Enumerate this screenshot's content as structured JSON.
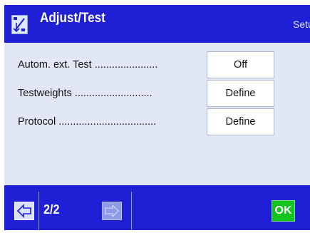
{
  "header": {
    "title": "Adjust/Test",
    "right_label": "Setup",
    "icon": "adjust-test-icon"
  },
  "rows": [
    {
      "label": "Autom. ext. Test ......................",
      "value": "Off"
    },
    {
      "label": "Testweights ...........................",
      "value": "Define"
    },
    {
      "label": "Protocol ..................................",
      "value": "Define"
    }
  ],
  "footer": {
    "page": "2/2",
    "back_icon": "arrow-left-icon",
    "forward_icon": "arrow-right-icon",
    "ok_label": "OK"
  },
  "colors": {
    "bar": "#1f1fd6",
    "content": "#e2e7f5",
    "ok": "#12c41c"
  }
}
